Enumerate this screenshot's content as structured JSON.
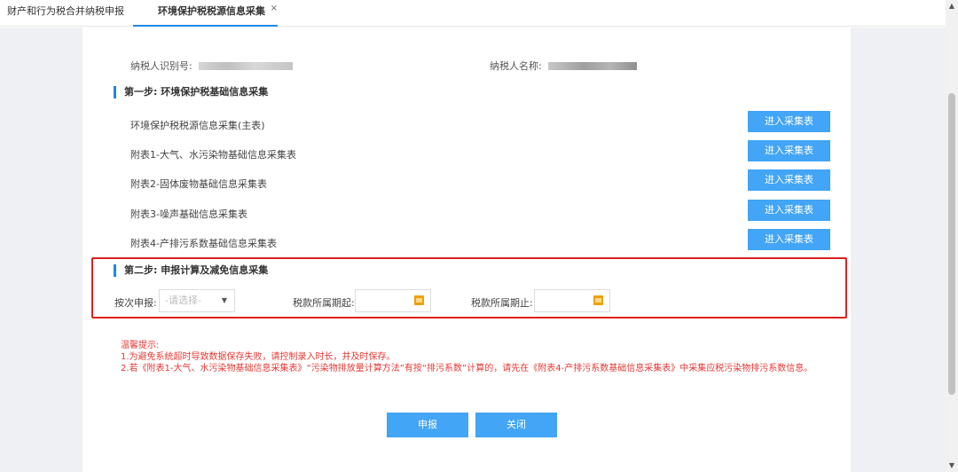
{
  "tabs": [
    {
      "label": "财产和行为税合并纳税申报"
    },
    {
      "label": "环境保护税税源信息采集",
      "close": "×"
    }
  ],
  "taxpayer": {
    "id_label": "纳税人识别号:",
    "name_label": "纳税人名称:"
  },
  "step1": {
    "title": "第一步: 环境保护税基础信息采集",
    "rows": [
      {
        "label": "环境保护税税源信息采集(主表)",
        "button": "进入采集表"
      },
      {
        "label": "附表1-大气、水污染物基础信息采集表",
        "button": "进入采集表"
      },
      {
        "label": "附表2-固体废物基础信息采集表",
        "button": "进入采集表"
      },
      {
        "label": "附表3-噪声基础信息采集表",
        "button": "进入采集表"
      },
      {
        "label": "附表4-产排污系数基础信息采集表",
        "button": "进入采集表"
      }
    ]
  },
  "step2": {
    "title": "第二步: 申报计算及减免信息采集",
    "declare_label": "按次申报:",
    "declare_placeholder": "-请选择-",
    "period_start_label": "税款所属期起:",
    "period_end_label": "税款所属期止:"
  },
  "tips": {
    "title": "温馨提示:",
    "line1": "1.为避免系统超时导致数据保存失败，请控制录入时长，并及时保存。",
    "line2": "2.若《附表1-大气、水污染物基础信息采集表》“污染物排放量计算方法”有按“排污系数”计算的，请先在《附表4-产排污系数基础信息采集表》中采集应税污染物排污系数信息。"
  },
  "actions": {
    "submit": "申报",
    "close": "关闭"
  },
  "icons": {
    "scroll_up": "triangle-up",
    "scroll_down": "triangle-down",
    "select_arrow": "triangle-down",
    "calendar": "calendar-icon"
  },
  "colors": {
    "accent": "#1e88e5",
    "button": "#42a5f5",
    "highlight_box": "#e02020",
    "tip_text": "#e53935"
  }
}
